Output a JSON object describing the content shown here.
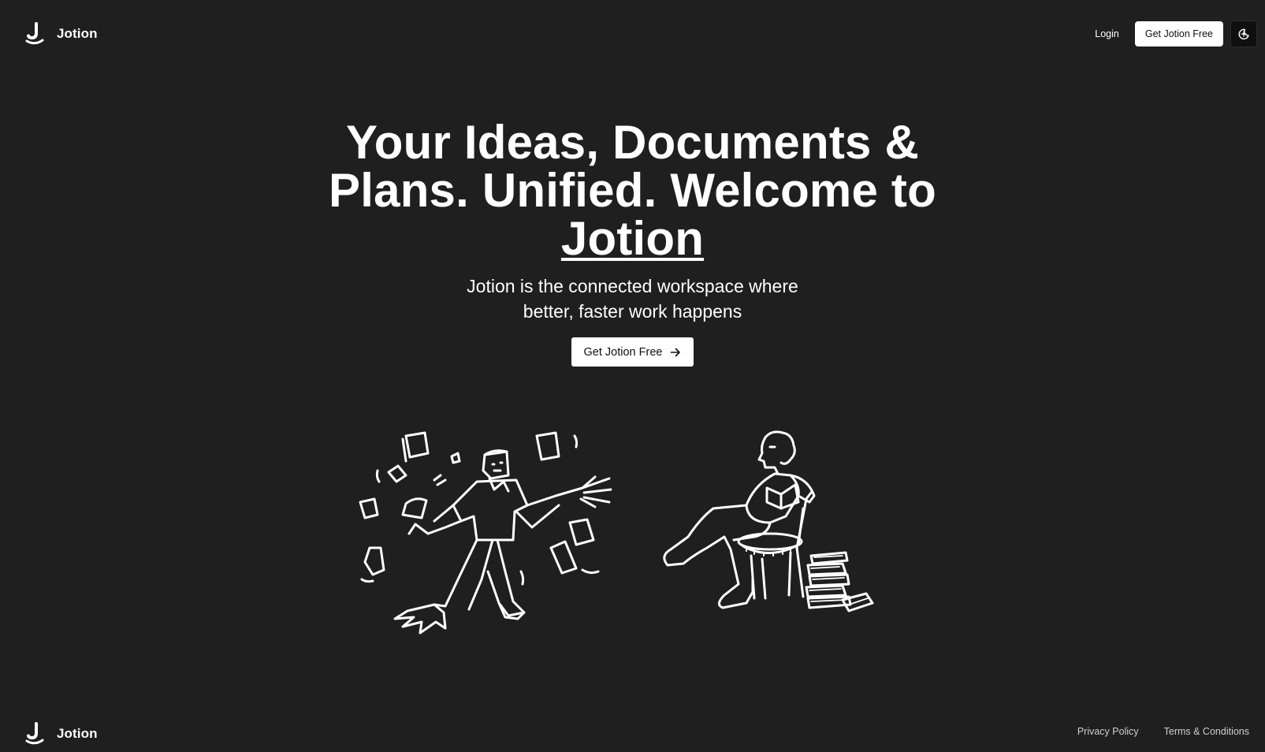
{
  "header": {
    "brand_name": "Jotion",
    "login_label": "Login",
    "cta_label": "Get Jotion Free",
    "theme_toggle_icon": "moon-sun-icon"
  },
  "hero": {
    "title_prefix": "Your Ideas, Documents & Plans. Unified. Welcome to ",
    "title_brand": "Jotion",
    "subtitle": "Jotion is the connected workspace where better, faster work happens",
    "cta_label": "Get Jotion Free",
    "cta_icon": "arrow-right-icon"
  },
  "illustrations": {
    "left": "person-juggling-documents-illustration",
    "right": "person-reading-in-chair-illustration"
  },
  "footer": {
    "brand_name": "Jotion",
    "links": [
      "Privacy Policy",
      "Terms & Conditions"
    ]
  },
  "colors": {
    "background": "#1f1f1f",
    "text": "#ffffff",
    "button_background": "#ffffff",
    "button_text": "#111111",
    "footer_link": "#cfcfcf"
  }
}
